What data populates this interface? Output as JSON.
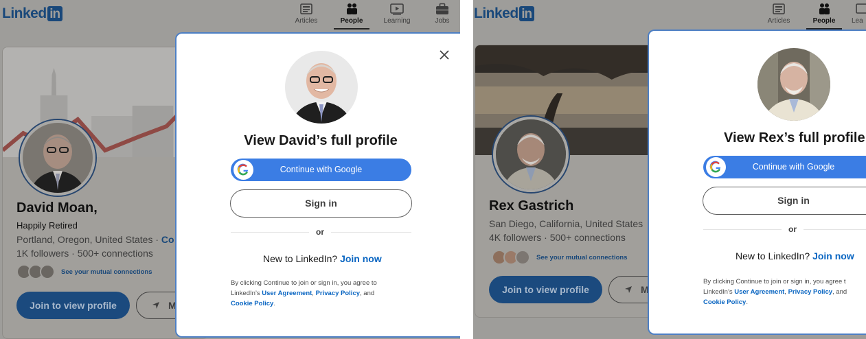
{
  "brand": {
    "word": "Linked",
    "box": "in"
  },
  "nav": {
    "articles": "Articles",
    "people": "People",
    "learning": "Learning",
    "jobs": "Jobs",
    "learning_truncated": "Lea"
  },
  "left": {
    "profile": {
      "name": "David Moan,",
      "headline": "Happily Retired",
      "location": "Portland, Oregon, United States",
      "location_extra": "Co",
      "followers": "1K followers",
      "connections": "500+ connections",
      "mutual": "See your mutual connections",
      "join_button": "Join to view profile",
      "message_button": "M"
    },
    "modal": {
      "title": "View David’s full profile",
      "google_button": "Continue with Google",
      "signin_button": "Sign in",
      "or": "or",
      "new_to": "New to LinkedIn?",
      "join_now": "Join now",
      "legal_1": "By clicking Continue to join or sign in, you agree to",
      "legal_2_prefix": "LinkedIn’s",
      "user_agreement": "User Agreement",
      "privacy_policy": "Privacy Policy",
      "legal_and": ", and",
      "cookie_policy": "Cookie Policy",
      "period": "."
    }
  },
  "right": {
    "profile": {
      "name": "Rex Gastrich",
      "location": "San Diego, California, United States",
      "followers": "4K followers",
      "connections": "500+ connections",
      "mutual": "See your mutual connections",
      "join_button": "Join to view profile",
      "message_button": "M"
    },
    "modal": {
      "title": "View Rex’s full profile",
      "google_button": "Continue with Google",
      "signin_button": "Sign in",
      "or": "or",
      "new_to": "New to LinkedIn?",
      "join_now": "Join now",
      "legal_1": "By clicking Continue to join or sign in, you agree t",
      "legal_2_prefix": "LinkedIn’s",
      "user_agreement": "User Agreement",
      "privacy_policy": "Privacy Policy",
      "legal_and": ", and",
      "cookie_policy": "Cookie Policy",
      "period": "."
    }
  },
  "colors": {
    "brand": "#0a66c2",
    "google_button": "#3b7de4",
    "join_button": "#1b4a7e",
    "modal_border": "#4d7fc4"
  },
  "icons": [
    "articles-icon",
    "people-icon",
    "learning-icon",
    "jobs-icon",
    "close-icon",
    "google-icon",
    "message-icon"
  ]
}
